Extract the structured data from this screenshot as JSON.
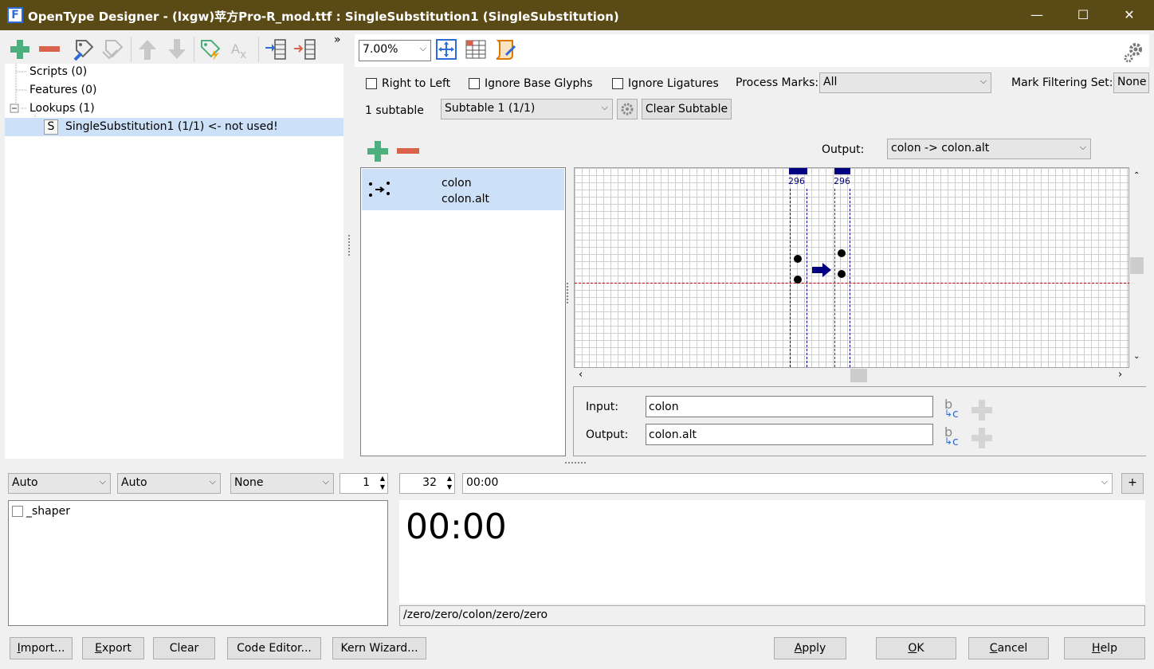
{
  "window": {
    "title": "OpenType Designer - (lxgw)苹方Pro-R_mod.ttf : SingleSubstitution1 (SingleSubstitution)",
    "app_icon": "F",
    "minimize": "—",
    "maximize": "☐",
    "close": "✕"
  },
  "toolbar": {
    "more": "»"
  },
  "tree": {
    "scripts": "Scripts (0)",
    "features": "Features (0)",
    "lookups": "Lookups (1)",
    "lookup_type_letter": "S",
    "lookup_item": "SingleSubstitution1 (1/1) <- not used!"
  },
  "view_toolbar": {
    "zoom": "7.00%"
  },
  "options": {
    "rtl_label": "Right to Left",
    "ignore_base_label": "Ignore Base Glyphs",
    "ignore_lig_label": "Ignore Ligatures",
    "process_marks_label": "Process Marks:",
    "process_marks_value": "All",
    "mark_filter_label": "Mark Filtering Set:",
    "mark_filter_value": "None"
  },
  "subtable": {
    "count_label": "1 subtable",
    "selected": "Subtable 1 (1/1)",
    "clear_button": "Clear Subtable"
  },
  "output_select": {
    "label": "Output:",
    "value": "colon -> colon.alt"
  },
  "rule_list": [
    {
      "input": "colon",
      "output": "colon.alt"
    }
  ],
  "preview": {
    "advance_left": "296",
    "advance_right": "296"
  },
  "editor": {
    "input_label": "Input:",
    "input_value": "colon",
    "output_label": "Output:",
    "output_value": "colon.alt",
    "glyph_btn_b": "b",
    "glyph_btn_c": "c"
  },
  "shaping": {
    "script": "Auto",
    "language": "Auto",
    "direction": "None",
    "count": "1",
    "font_size": "32",
    "text": "00:00",
    "add": "+",
    "feature_item": "_shaper",
    "sample": "00:00",
    "glyph_path": "/zero/zero/colon/zero/zero"
  },
  "footer": {
    "import": "Import...",
    "export": "Export",
    "clear": "Clear",
    "code_editor": "Code Editor...",
    "kern_wizard": "Kern Wizard...",
    "apply": "Apply",
    "ok": "OK",
    "cancel": "Cancel",
    "help": "Help"
  },
  "colors": {
    "titlebar": "#5a4a15",
    "add_green": "#4caf7d",
    "remove_red": "#d9634a",
    "selection": "#cce0f8",
    "guide_blue": "#000080",
    "baseline_red": "#c00000"
  },
  "icons": [
    "add-icon",
    "remove-icon",
    "edit-tag-icon",
    "tag-icon",
    "arrow-up-icon",
    "arrow-down-icon",
    "tag-lightning-icon",
    "spell-check-icon",
    "list-import-icon",
    "list-export-icon",
    "fit-view-icon",
    "grid-view-icon",
    "script-icon",
    "settings-gear-icon"
  ]
}
